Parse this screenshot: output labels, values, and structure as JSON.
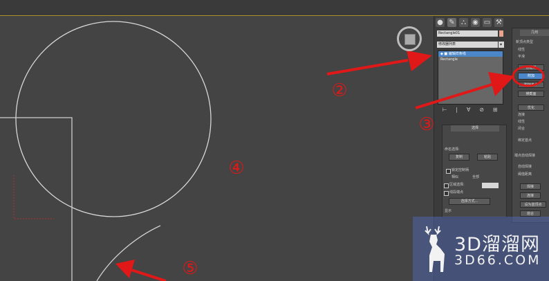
{
  "toolbar": {
    "title_bar": ""
  },
  "command_panel": {
    "tabs": [
      {
        "icon": "create-icon",
        "glyph": "●"
      },
      {
        "icon": "modify-icon",
        "glyph": "✎"
      },
      {
        "icon": "hierarchy-icon",
        "glyph": "⛬"
      },
      {
        "icon": "motion-icon",
        "glyph": "◉"
      },
      {
        "icon": "display-icon",
        "glyph": "▭"
      },
      {
        "icon": "utilities-icon",
        "glyph": "⚒"
      }
    ],
    "object_name": "Rectangle01",
    "modifier_list": "修改器列表",
    "stack_items": [
      {
        "label": "◆ ■ 编辑样条线",
        "selected": true
      },
      {
        "label": "Rectangle",
        "selected": false
      }
    ],
    "stack_tools": [
      "⊢",
      "|",
      "∀",
      "⊘",
      "⊞"
    ],
    "swatch_color": "#e8a48c"
  },
  "rollouts": {
    "selection": {
      "title": "选择",
      "label": "命名选择:",
      "copy_button": "复制",
      "paste_button": "粘贴",
      "lock_handles": "锁定控制柄",
      "similar": "相似",
      "all": "全部",
      "area_select": "区域选择:",
      "segment_end": "线段端点",
      "select_by": "选择方式...",
      "display": "显示"
    },
    "geometry": {
      "title": "几何",
      "new_vertex_type": "新顶点类型",
      "linear": "线性",
      "smooth": "平滑",
      "bezier": "Bezier",
      "create_line": "创建线",
      "attach_button": "附加",
      "attach_multiple": "附加多个",
      "cross_section": "横截面",
      "refine": "优化",
      "connect": "连接",
      "linear2": "线性",
      "closed": "闭合",
      "bind_first": "绑定首点",
      "end_point_auto_weld": "端点自动焊接",
      "auto_weld": "自动焊接",
      "threshold": "阈值距离",
      "weld": "焊接",
      "connect2": "连接",
      "insert": "插入",
      "set_first": "设为首顶点",
      "fuse": "熔合"
    }
  },
  "annotations": {
    "n2": "②",
    "n3": "③",
    "n4": "④",
    "n5": "⑤",
    "color": "#e01818"
  },
  "watermark": {
    "text1": "3D溜溜网",
    "text2": "3D66.COM"
  }
}
